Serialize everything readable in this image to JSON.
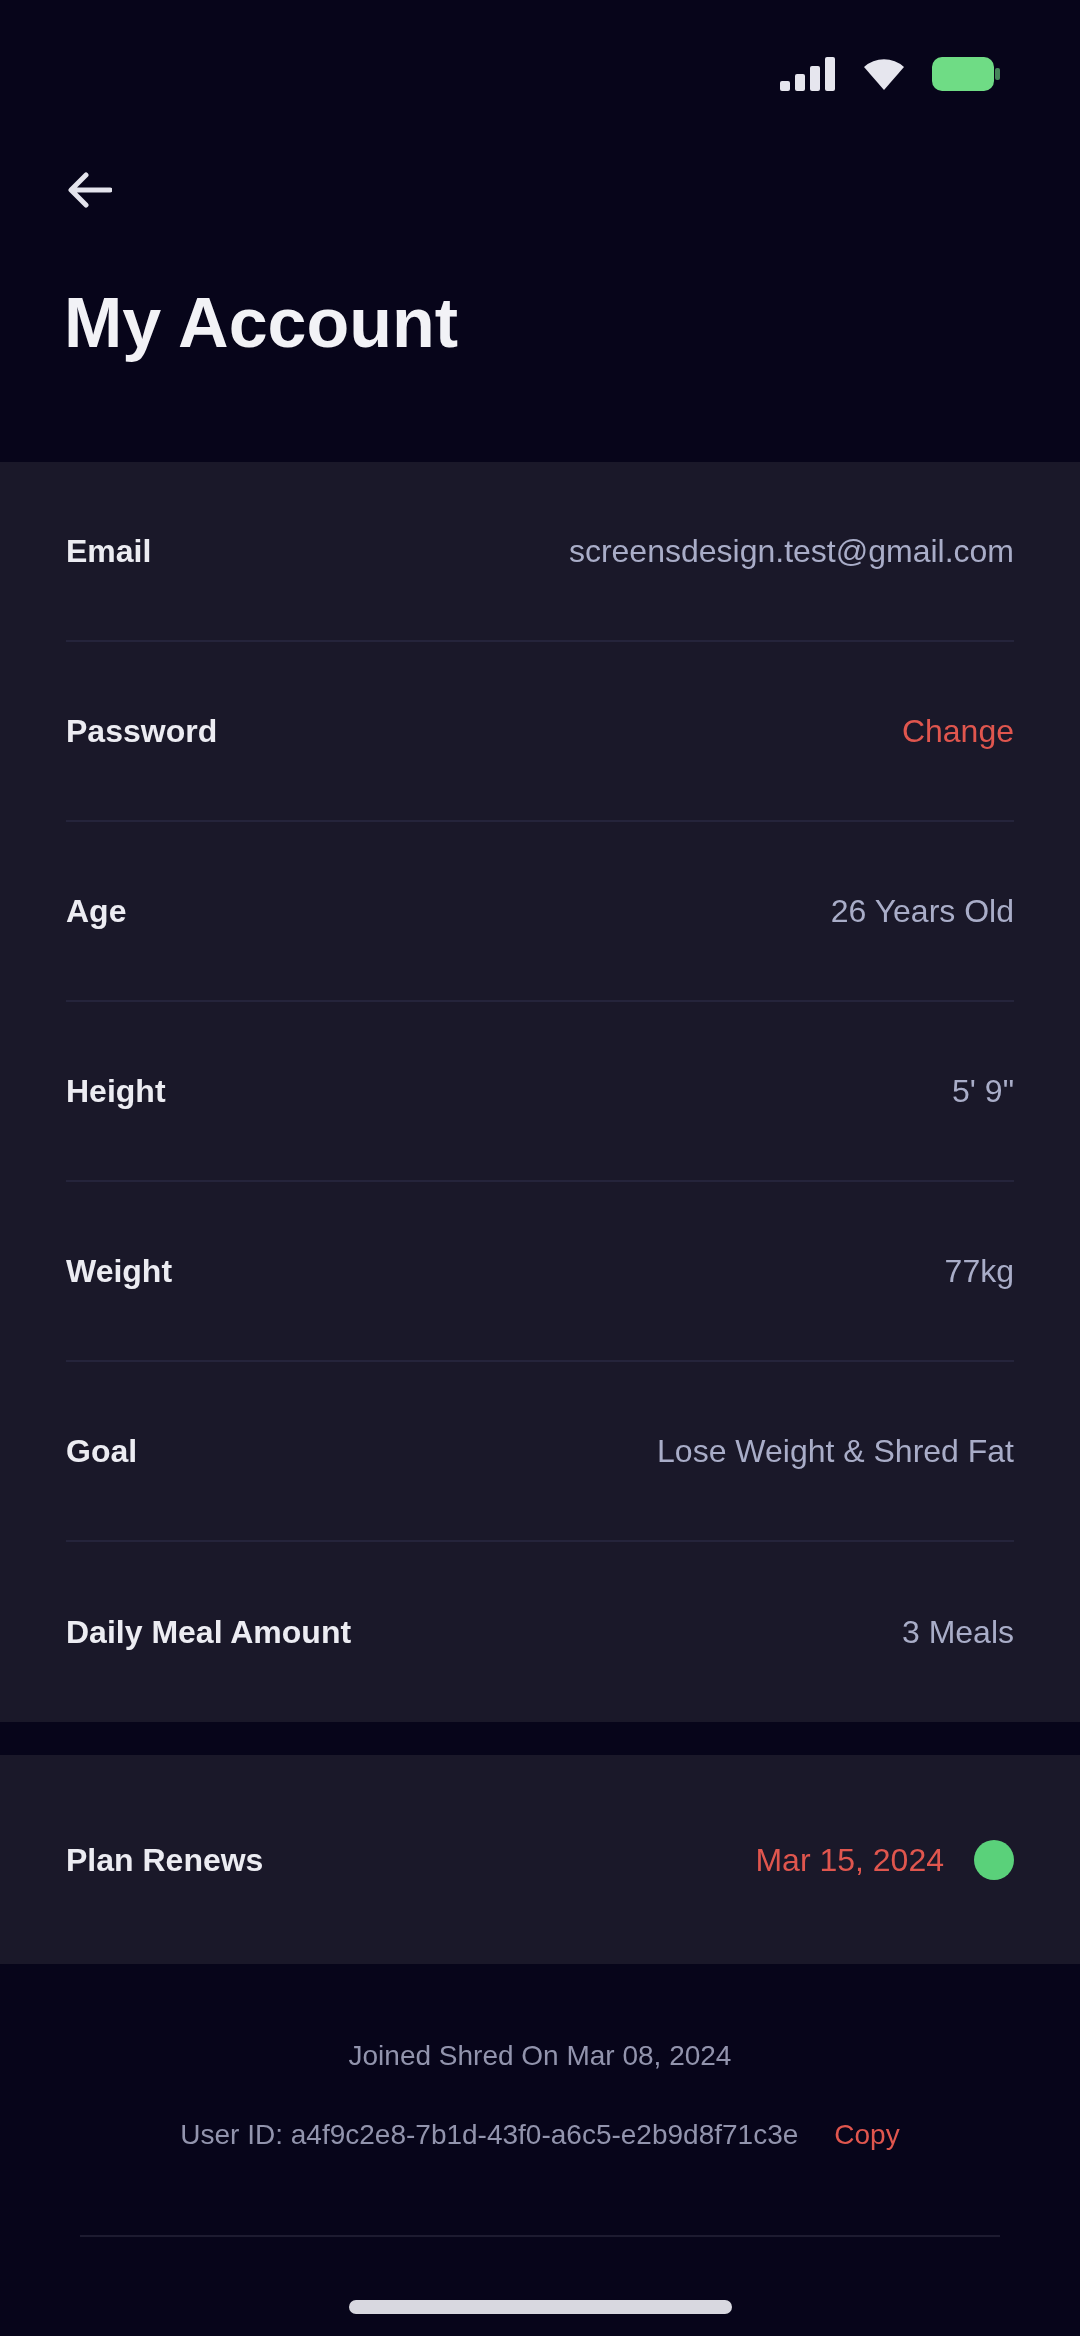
{
  "status_bar": {
    "battery_charging": true
  },
  "title": "My Account",
  "profile": [
    {
      "label": "Email",
      "value": "screensdesign.test@gmail.com",
      "kind": "text"
    },
    {
      "label": "Password",
      "value": "Change",
      "kind": "link"
    },
    {
      "label": "Age",
      "value": "26 Years Old",
      "kind": "text"
    },
    {
      "label": "Height",
      "value": "5' 9\"",
      "kind": "text"
    },
    {
      "label": "Weight",
      "value": "77kg",
      "kind": "text"
    },
    {
      "label": "Goal",
      "value": "Lose Weight & Shred Fat",
      "kind": "text"
    },
    {
      "label": "Daily Meal Amount",
      "value": "3 Meals",
      "kind": "text"
    }
  ],
  "plan": {
    "label": "Plan Renews",
    "value": "Mar 15, 2024",
    "active": true
  },
  "footer": {
    "joined": "Joined Shred On Mar 08, 2024",
    "user_id": "User ID: a4f9c2e8-7b1d-43f0-a6c5-e2b9d8f71c3e",
    "copy": "Copy"
  }
}
